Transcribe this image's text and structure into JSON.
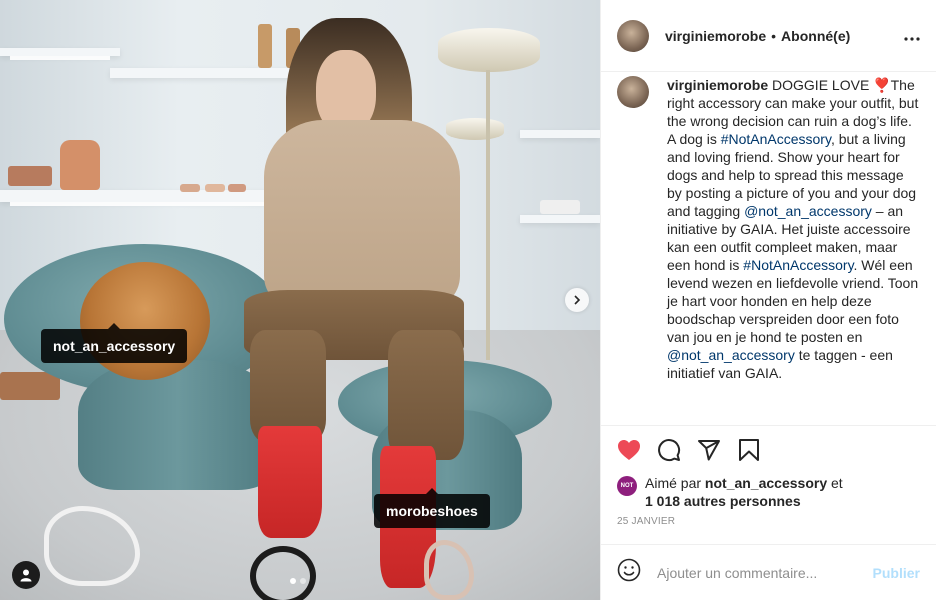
{
  "photo": {
    "tags": [
      {
        "name": "tag-not-an-accessory",
        "label": "not_an_accessory"
      },
      {
        "name": "tag-morobeshoes",
        "label": "morobeshoes"
      }
    ],
    "carousel": {
      "slides": 2,
      "active": 1
    }
  },
  "header": {
    "username": "virginiemorobe",
    "separator": "•",
    "follow_state": "Abonné(e)",
    "more_icon": "more-horizontal-icon"
  },
  "caption": {
    "username": "virginiemorobe",
    "parts": [
      {
        "text": " DOGGIE LOVE ❣️The right accessory can make your outfit, but the wrong decision can ruin a dog’s life. A dog is ",
        "link": false
      },
      {
        "text": "#NotAnAccessory",
        "link": true
      },
      {
        "text": ", but a living and loving friend. Show your heart for dogs and help to spread this message by posting a picture of you and your dog and tagging ",
        "link": false
      },
      {
        "text": "@not_an_accessory",
        "link": true
      },
      {
        "text": " – an initiative by GAIA. Het juiste accessoire kan een outfit compleet maken, maar een hond is ",
        "link": false
      },
      {
        "text": "#NotAnAccessory",
        "link": true
      },
      {
        "text": ". Wél een levend wezen en liefdevolle vriend. Toon je hart voor honden en help deze boodschap verspreiden door een foto van jou en je hond te posten en ",
        "link": false
      },
      {
        "text": "@not_an_accessory",
        "link": true
      },
      {
        "text": " te taggen - een initiatief van GAIA.",
        "link": false
      }
    ]
  },
  "actions": {
    "like_icon": "heart-filled-icon",
    "comment_icon": "comment-icon",
    "share_icon": "share-icon",
    "save_icon": "bookmark-icon",
    "like_color": "#ed4956"
  },
  "likes": {
    "avatar_text": "NOT",
    "prefix": "Aimé par ",
    "user": "not_an_accessory",
    "joiner": " et",
    "others": "1 018 autres personnes"
  },
  "date": "25 JANVIER",
  "comment": {
    "emoji_icon": "emoji-icon",
    "placeholder": "Ajouter un commentaire...",
    "publish_label": "Publier"
  }
}
